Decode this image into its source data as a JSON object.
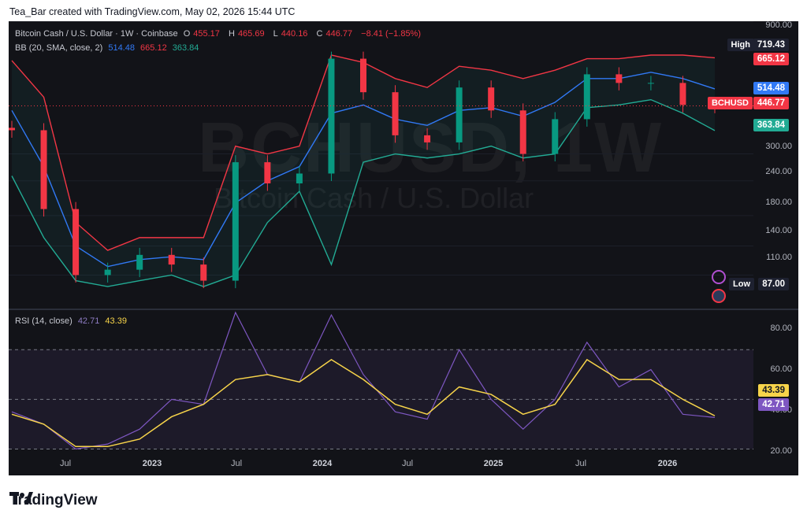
{
  "caption": "Tea_Bar created with TradingView.com, May 02, 2026 15:44 UTC",
  "brand": "TradingView",
  "main_legend": {
    "symbol": "Bitcoin Cash / U.S. Dollar · 1W · Coinbase",
    "o_label": "O",
    "o": "455.17",
    "h_label": "H",
    "h": "465.69",
    "l_label": "L",
    "l": "440.16",
    "c_label": "C",
    "c": "446.77",
    "change": "−8.41 (−1.85%)"
  },
  "bb_legend": {
    "name": "BB (20, SMA, close, 2)",
    "basis": "514.48",
    "upper": "665.12",
    "lower": "363.84"
  },
  "rsi_legend": {
    "name": "RSI (14, close)",
    "rsi": "42.71",
    "ma": "43.39"
  },
  "watermark": {
    "symbol": "BCHUSD, 1W",
    "name": "Bitcoin Cash / U.S. Dollar"
  },
  "tags": {
    "high_label": "High",
    "high_value": "719.43",
    "upper": "665.12",
    "basis": "514.48",
    "symbol": "BCHUSD",
    "price": "446.77",
    "lower": "363.84",
    "low_label": "Low",
    "low_value": "87.00",
    "rsi_ma": "43.39",
    "rsi": "42.71"
  },
  "price_axis": [
    "900.00",
    "300.00",
    "240.00",
    "180.00",
    "140.00",
    "110.00"
  ],
  "rsi_axis": [
    "80.00",
    "60.00",
    "40.00",
    "20.00"
  ],
  "x_axis": [
    {
      "label": "Jul",
      "bold": false
    },
    {
      "label": "2023",
      "bold": true
    },
    {
      "label": "Jul",
      "bold": false
    },
    {
      "label": "2024",
      "bold": true
    },
    {
      "label": "Jul",
      "bold": false
    },
    {
      "label": "2025",
      "bold": true
    },
    {
      "label": "Jul",
      "bold": false
    },
    {
      "label": "2026",
      "bold": true
    }
  ],
  "colors": {
    "background": "#121318",
    "up": "#089981",
    "down": "#f23645",
    "bb_upper": "#f23645",
    "bb_basis": "#3179f5",
    "bb_lower": "#22ab94",
    "rsi": "#7e57c2",
    "rsi_ma": "#f7d44a"
  },
  "chart_data": [
    {
      "type": "candlestick",
      "title": "Bitcoin Cash / U.S. Dollar · 1W · Coinbase",
      "scale": "log",
      "ylim": [
        85,
        900
      ],
      "y_ticks": [
        110,
        140,
        180,
        240,
        300,
        900
      ],
      "x_ticks": [
        "Jul",
        "2023",
        "Jul",
        "2024",
        "Jul",
        "2025",
        "Jul",
        "2026"
      ],
      "series": [
        {
          "name": "BCHUSD close",
          "x": [
            "2022-03",
            "2022-05",
            "2022-07",
            "2022-10",
            "2023-01",
            "2023-04",
            "2023-06",
            "2023-07",
            "2023-10",
            "2023-12",
            "2024-03",
            "2024-04",
            "2024-07",
            "2024-09",
            "2024-12",
            "2025-01",
            "2025-03",
            "2025-05",
            "2025-08",
            "2025-10",
            "2025-12",
            "2026-02",
            "2026-04"
          ],
          "values": [
            365,
            190,
            110,
            115,
            130,
            120,
            105,
            280,
            235,
            255,
            660,
            500,
            350,
            330,
            520,
            430,
            300,
            400,
            580,
            540,
            540,
            450,
            447
          ]
        },
        {
          "name": "BB upper",
          "values": [
            650,
            480,
            170,
            135,
            150,
            150,
            150,
            320,
            300,
            320,
            680,
            640,
            560,
            520,
            620,
            600,
            560,
            600,
            660,
            660,
            680,
            680,
            665
          ]
        },
        {
          "name": "BB basis",
          "values": [
            430,
            270,
            140,
            118,
            125,
            128,
            125,
            200,
            240,
            270,
            420,
            450,
            400,
            380,
            430,
            440,
            410,
            460,
            560,
            560,
            590,
            560,
            514
          ]
        },
        {
          "name": "BB lower",
          "values": [
            250,
            150,
            105,
            100,
            105,
            110,
            100,
            110,
            170,
            220,
            120,
            280,
            300,
            290,
            300,
            320,
            290,
            300,
            440,
            450,
            470,
            420,
            364
          ]
        }
      ],
      "last_price": 446.77,
      "high": 719.43,
      "low": 87.0
    },
    {
      "type": "line",
      "title": "RSI (14, close)",
      "ylim": [
        20,
        85
      ],
      "y_ticks": [
        20,
        40,
        60,
        80
      ],
      "levels": [
        70,
        50,
        30
      ],
      "series": [
        {
          "name": "RSI",
          "values": [
            45,
            40,
            30,
            32,
            38,
            50,
            48,
            85,
            60,
            57,
            84,
            60,
            45,
            42,
            70,
            50,
            38,
            50,
            73,
            55,
            62,
            44,
            42.71
          ]
        },
        {
          "name": "RSI MA",
          "values": [
            44,
            40,
            31,
            31,
            34,
            43,
            48,
            58,
            60,
            57,
            66,
            58,
            48,
            44,
            55,
            52,
            44,
            48,
            66,
            58,
            58,
            50,
            43.39
          ]
        }
      ]
    }
  ]
}
